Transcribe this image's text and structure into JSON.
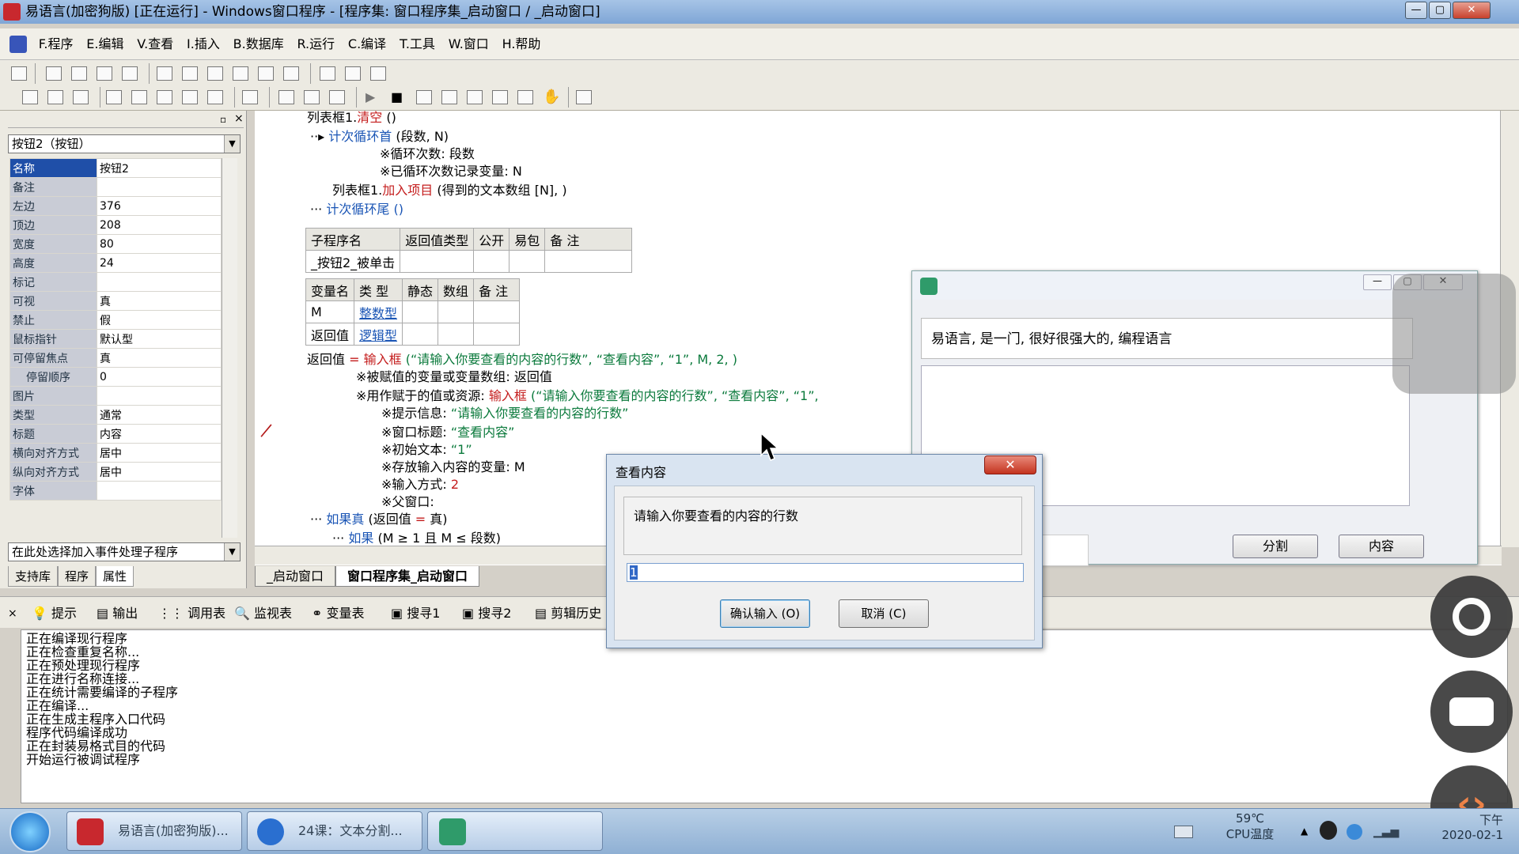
{
  "window": {
    "title": "易语言(加密狗版) [正在运行] - Windows窗口程序 - [程序集: 窗口程序集_启动窗口 / _启动窗口]",
    "min": "—",
    "max": "▢",
    "close": "✕"
  },
  "menu": [
    "F.程序",
    "E.编辑",
    "V.查看",
    "I.插入",
    "B.数据库",
    "R.运行",
    "C.编译",
    "T.工具",
    "W.窗口",
    "H.帮助"
  ],
  "left_panel": {
    "component_select": "按钮2（按钮）",
    "properties": [
      {
        "k": "名称",
        "v": "按钮2"
      },
      {
        "k": "备注",
        "v": ""
      },
      {
        "k": "左边",
        "v": "376"
      },
      {
        "k": "顶边",
        "v": "208"
      },
      {
        "k": "宽度",
        "v": "80"
      },
      {
        "k": "高度",
        "v": "24"
      },
      {
        "k": "标记",
        "v": ""
      },
      {
        "k": "可视",
        "v": "真"
      },
      {
        "k": "禁止",
        "v": "假"
      },
      {
        "k": "鼠标指针",
        "v": "默认型"
      },
      {
        "k": "可停留焦点",
        "v": "真"
      },
      {
        "k": "停留顺序",
        "v": "0"
      },
      {
        "k": "图片",
        "v": ""
      },
      {
        "k": "类型",
        "v": "通常"
      },
      {
        "k": "标题",
        "v": "内容"
      },
      {
        "k": "横向对齐方式",
        "v": "居中"
      },
      {
        "k": "纵向对齐方式",
        "v": "居中"
      },
      {
        "k": "字体",
        "v": ""
      }
    ],
    "event_select": "在此处选择加入事件处理子程序",
    "tabs": [
      "支持库",
      "程序",
      "属性"
    ]
  },
  "code": {
    "line1_obj": "列表框1.",
    "line1_method": "清空",
    "line1_args": " ()",
    "loop_start": "计次循环首",
    "loop_args": " (段数, N)",
    "loop_note1": "※循环次数: 段数",
    "loop_note2": "※已循环次数记录变量: N",
    "add_item_obj": "列表框1.",
    "add_item_method": "加入项目",
    "add_item_args": " (得到的文本数组 [N], )",
    "loop_end": "计次循环尾",
    "loop_end_args": " ()",
    "sub_table": {
      "headers": [
        "子程序名",
        "返回值类型",
        "公开",
        "易包",
        "备 注"
      ],
      "row": [
        "_按钮2_被单击",
        "",
        "",
        "",
        ""
      ]
    },
    "var_table": {
      "headers": [
        "变量名",
        "类 型",
        "静态",
        "数组",
        "备 注"
      ],
      "rows": [
        [
          "M",
          "整数型",
          "",
          "",
          ""
        ],
        [
          "返回值",
          "逻辑型",
          "",
          "",
          ""
        ]
      ]
    },
    "assign_lhs": "返回值 ",
    "assign_eq": "= ",
    "assign_func": "输入框",
    "assign_args": " (“请输入你要查看的内容的行数”, “查看内容”, “1”, M, 2, )",
    "note_var": "※被赋值的变量或变量数组: 返回值",
    "note_value_label": "※用作赋于的值或资源: ",
    "note_value_func": "输入框",
    "note_value_args": " (“请输入你要查看的内容的行数”, “查看内容”, “1”,",
    "p1_label": "※提示信息: ",
    "p1_val": "“请输入你要查看的内容的行数”",
    "p2_label": "※窗口标题: ",
    "p2_val": "“查看内容”",
    "p3_label": "※初始文本: ",
    "p3_val": "“1”",
    "p4": "※存放输入内容的变量: M",
    "p5_label": "※输入方式: ",
    "p5_val": "2",
    "p6": "※父窗口:",
    "if_kw": "如果真",
    "if_args": " (返回值 ",
    "if_eq": "= ",
    "if_val": "真)",
    "if2_kw": "如果",
    "if2_args": " (M ≥ 1 且 M ≤ 段数)"
  },
  "code_tabs": [
    "_启动窗口",
    "窗口程序集_启动窗口"
  ],
  "output_tabs": [
    "提示",
    "输出",
    "调用表",
    "监视表",
    "变量表",
    "搜寻1",
    "搜寻2",
    "剪辑历史"
  ],
  "output_lines": [
    "正在编译现行程序",
    "正在检查重复名称...",
    "正在预处理现行程序",
    "正在进行名称连接...",
    "正在统计需要编译的子程序",
    "正在编译...",
    "正在生成主程序入口代码",
    "程序代码编译成功",
    "正在封装易格式目的代码",
    "开始运行被调试程序"
  ],
  "app_window": {
    "text": "易语言, 是一门, 很好很强大的, 编程语言",
    "btn_split": "分割",
    "btn_content": "内容"
  },
  "dialog": {
    "title": "查看内容",
    "close": "✕",
    "prompt": "请输入你要查看的内容的行数",
    "input_value": "1",
    "ok": "确认输入 (O)",
    "cancel": "取消 (C)"
  },
  "taskbar": {
    "items": [
      "易语言(加密狗版)...",
      "24课：文本分割...",
      ""
    ],
    "temp": "59℃",
    "temp_label": "CPU温度",
    "clock_top": "下午",
    "clock_date": "2020-02-1"
  },
  "colors": {
    "keyword": "#1a55b5",
    "string": "#0b7a3c",
    "func": "#c41c1c",
    "selection": "#1f4fa8"
  }
}
